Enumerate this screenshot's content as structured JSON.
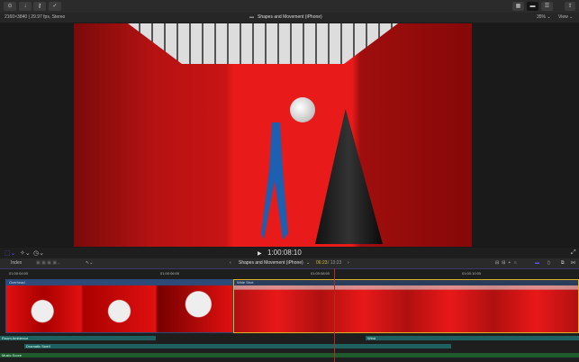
{
  "toolbar": {
    "left_icons": [
      "media-import-icon",
      "download-icon",
      "key-icon",
      "check-circle-icon"
    ],
    "right_icons": [
      "grid-view-icon",
      "viewer-icon",
      "inspector-icon",
      "share-icon"
    ]
  },
  "info": {
    "format": "2160×3840 | 29.97 fps, Stereo",
    "project": "Shapes and Movement (iPhone)",
    "zoom": "35%",
    "view": "View"
  },
  "viewer": {
    "timecode": "1:00:08:10"
  },
  "timeline_toolbar": {
    "index": "Index",
    "project": "Shapes and Movement (iPhone)",
    "position": "06:23",
    "duration": "13:23"
  },
  "ruler": [
    "01:00:04:00",
    "01:00:06:00",
    "01:00:08:00",
    "01:00:10:00"
  ],
  "clips": [
    {
      "name": "Overhead"
    },
    {
      "name": "Wide Shot"
    }
  ],
  "audio": [
    {
      "name": "Room Ambience"
    },
    {
      "name": "Wind"
    },
    {
      "name": "Dramatic Swell"
    },
    {
      "name": "Music Score"
    }
  ]
}
